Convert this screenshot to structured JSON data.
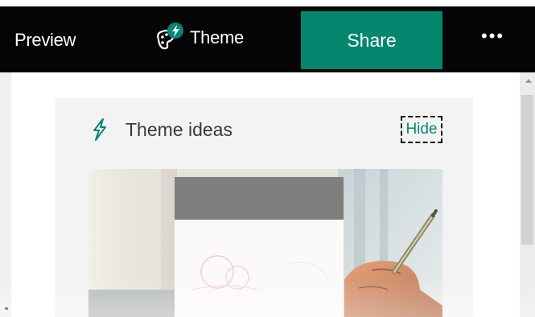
{
  "toolbar": {
    "preview_label": "Preview",
    "theme_label": "Theme",
    "share_label": "Share",
    "more_label": "•••",
    "share_color": "#03876f",
    "background_color": "#050505"
  },
  "theme_panel": {
    "title": "Theme ideas",
    "hide_label": "Hide",
    "icon": "lightning-bolt-icon",
    "accent_color": "#03876f"
  }
}
